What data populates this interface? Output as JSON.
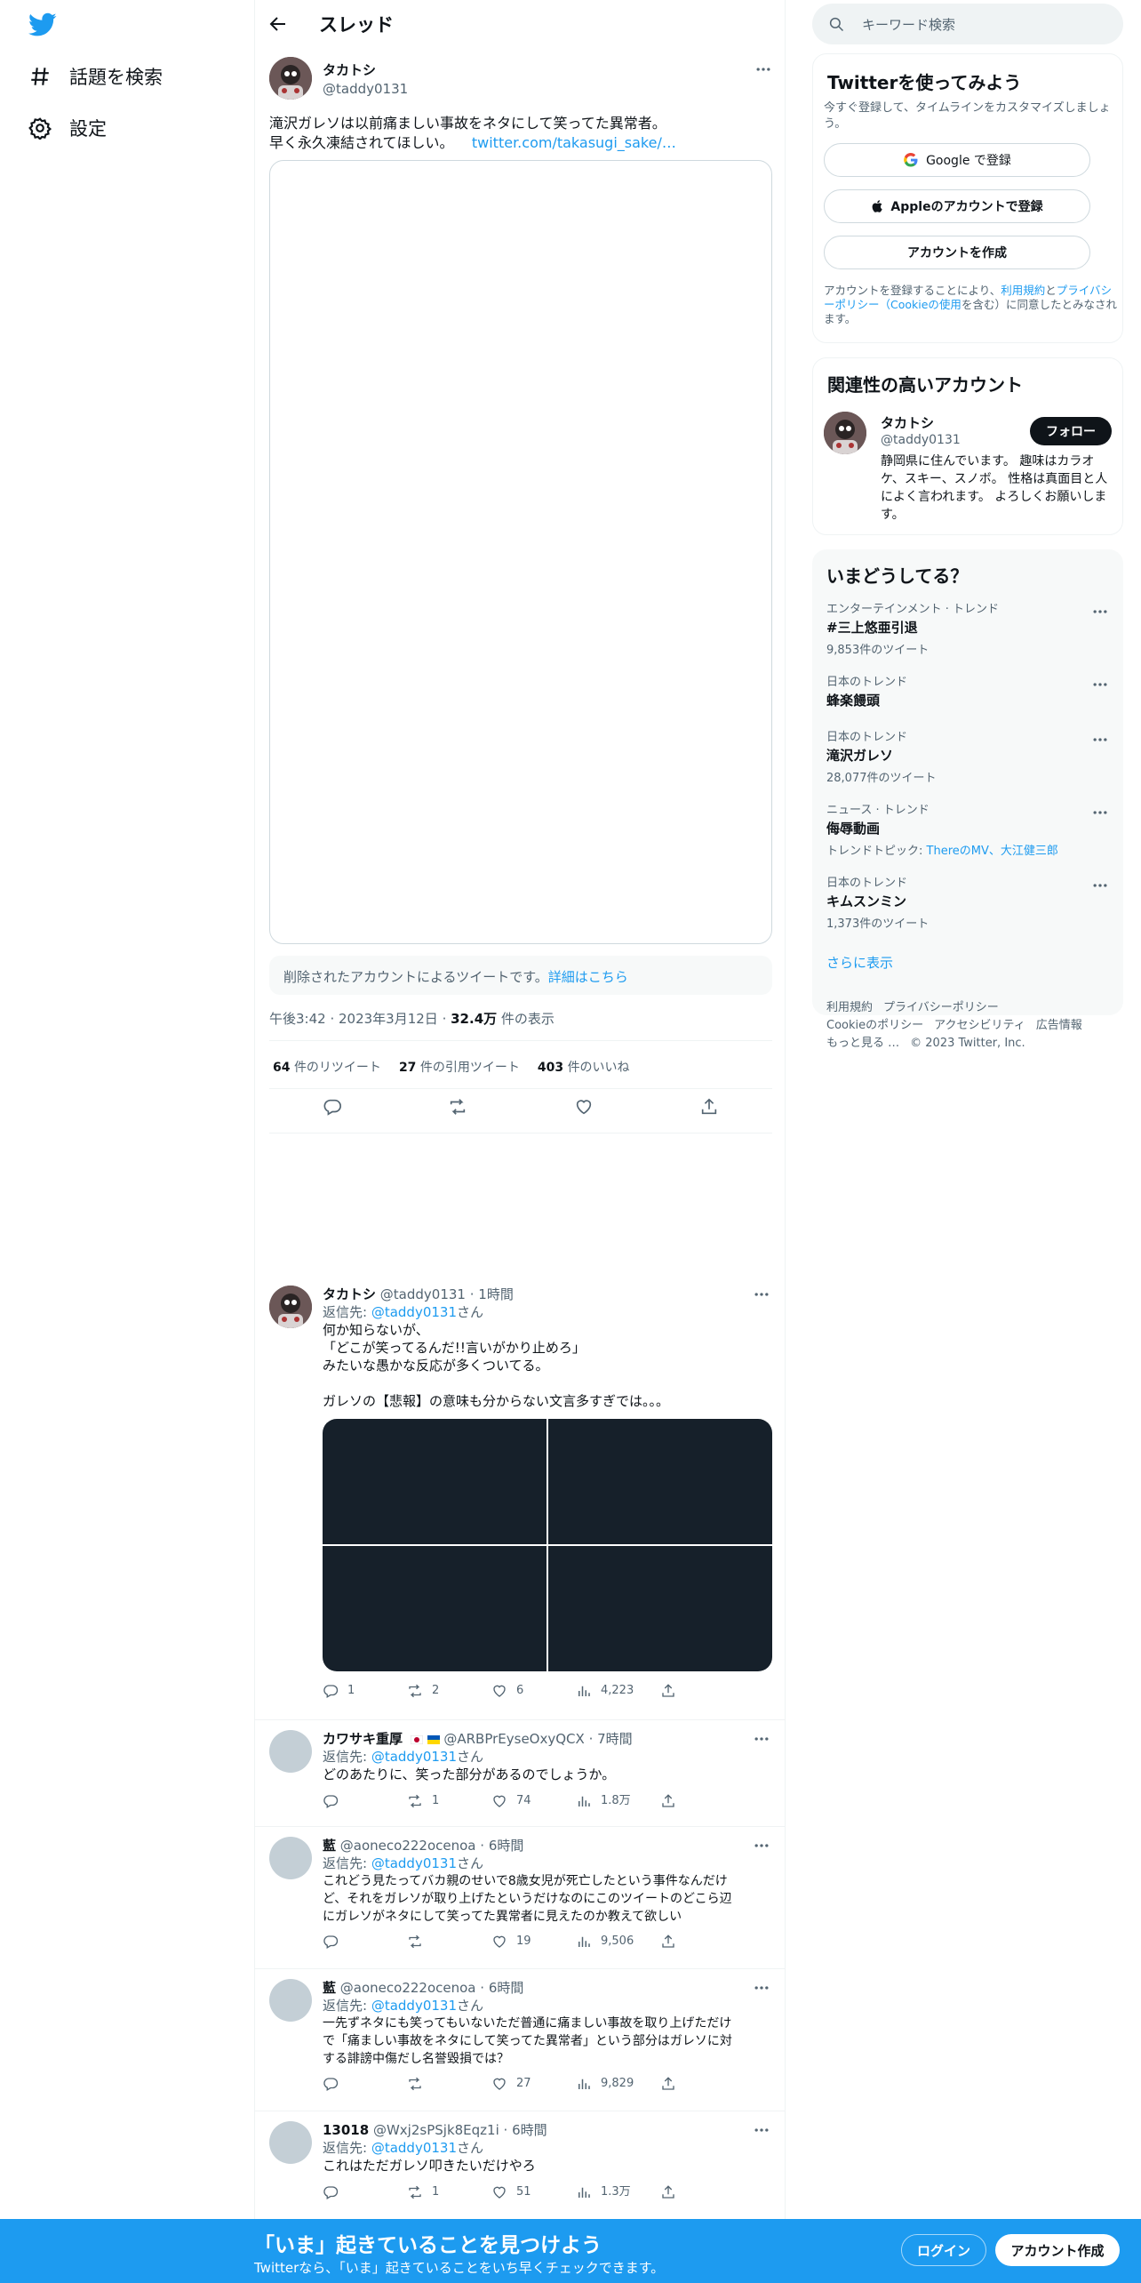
{
  "nav": {
    "explore": "話題を検索",
    "settings": "設定"
  },
  "header": {
    "title": "スレッド"
  },
  "main_tweet": {
    "name": "タカトシ",
    "handle": "@taddy0131",
    "text_line1": "滝沢ガレソは以前痛ましい事故をネタにして笑ってた異常者。",
    "text_line2": "早く永久凍結されてほしい。",
    "link": "twitter.com/takasugi_sake/…",
    "deleted_notice": "削除されたアカウントによるツイートです。",
    "deleted_link": "詳細はこちら",
    "time": "午後3:42",
    "date": "2023年3月12日",
    "views_count": "32.4万",
    "views_label": "件の表示",
    "retweets_count": "64",
    "retweets_label": "件のリツイート",
    "quotes_count": "27",
    "quotes_label": "件の引用ツイート",
    "likes_count": "403",
    "likes_label": "件のいいね"
  },
  "replies": [
    {
      "name": "タカトシ",
      "handle": "@taddy0131",
      "time": "1時間",
      "reply_to_prefix": "返信先: ",
      "reply_to": "@taddy0131",
      "reply_to_suffix": "さん",
      "lines": [
        "何か知らないが、",
        "「どこが笑ってるんだ!!言いがかり止めろ」",
        "みたいな愚かな反応が多くついてる。",
        "",
        "ガレソの【悲報】の意味も分からない文言多すぎでは。。。"
      ],
      "replies": "1",
      "retweets": "2",
      "likes": "6",
      "views": "4,223"
    },
    {
      "name": "カワサキ重厚",
      "handle": "@ARBPrEyseOxyQCX",
      "time": "7時間",
      "reply_to_prefix": "返信先: ",
      "reply_to": "@taddy0131",
      "reply_to_suffix": "さん",
      "lines": [
        "どのあたりに、笑った部分があるのでしょうか。"
      ],
      "replies": "",
      "retweets": "1",
      "likes": "74",
      "views": "1.8万"
    },
    {
      "name": "藍",
      "handle": "@aoneco222ocenoa",
      "time": "6時間",
      "reply_to_prefix": "返信先: ",
      "reply_to": "@taddy0131",
      "reply_to_suffix": "さん",
      "lines": [
        "これどう見たってバカ親のせいで8歳女児が死亡したという事件なんだけ",
        "ど、それをガレソが取り上げたというだけなのにこのツイートのどこら辺",
        "にガレソがネタにして笑ってた異常者に見えたのか教えて欲しい"
      ],
      "replies": "",
      "retweets": "",
      "likes": "19",
      "views": "9,506"
    },
    {
      "name": "藍",
      "handle": "@aoneco222ocenoa",
      "time": "6時間",
      "reply_to_prefix": "返信先: ",
      "reply_to": "@taddy0131",
      "reply_to_suffix": "さん",
      "lines": [
        "一先ずネタにも笑ってもいないただ普通に痛ましい事故を取り上げただけ",
        "で「痛ましい事故をネタにして笑ってた異常者」という部分はガレソに対",
        "する誹謗中傷だし名誉毀損では？"
      ],
      "replies": "",
      "retweets": "",
      "likes": "27",
      "views": "9,829"
    },
    {
      "name": "13018",
      "handle": "@Wxj2sPSjk8Eqz1i",
      "time": "6時間",
      "reply_to_prefix": "返信先: ",
      "reply_to": "@taddy0131",
      "reply_to_suffix": "さん",
      "lines": [
        "これはただガレソ叩きたいだけやろ"
      ],
      "replies": "",
      "retweets": "1",
      "likes": "51",
      "views": "1.3万"
    }
  ],
  "sidebar": {
    "search_placeholder": "キーワード検索",
    "signup_title": "Twitterを使ってみよう",
    "signup_desc": "今すぐ登録して、タイムラインをカスタマイズしましょう。",
    "google_btn": "Google で登録",
    "apple_btn": "Appleのアカウントで登録",
    "create_btn": "アカウントを作成",
    "terms_pre": "アカウントを登録することにより、",
    "terms_link1": "利用規約",
    "terms_and": "と",
    "terms_link2": "プライバシーポリシー（Cookieの使用",
    "terms_post": "を含む）に同意したとみなされます。",
    "related_title": "関連性の高いアカウント",
    "related_name": "タカトシ",
    "related_handle": "@taddy0131",
    "follow_btn": "フォロー",
    "related_bio": "静岡県に住んでいます。 趣味はカラオケ、スキー、スノボ。 性格は真面目と人によく言われます。 よろしくお願いします。",
    "trends_title": "いまどうしてる？",
    "trends": [
      {
        "category": "エンターテインメント · トレンド",
        "name": "#三上悠亜引退",
        "count": "9,853件のツイート"
      },
      {
        "category": "日本のトレンド",
        "name": "蜂楽饅頭",
        "count": ""
      },
      {
        "category": "日本のトレンド",
        "name": "滝沢ガレソ",
        "count": "28,077件のツイート"
      },
      {
        "category": "ニュース · トレンド",
        "name": "侮辱動画",
        "count_prefix": "トレンドトピック: ",
        "count_links": "ThereのMV、大江健三郎"
      },
      {
        "category": "日本のトレンド",
        "name": "キムスンミン",
        "count": "1,373件のツイート"
      }
    ],
    "show_more": "さらに表示",
    "footer": [
      "利用規約",
      "プライバシーポリシー",
      "Cookieのポリシー",
      "アクセシビリティ",
      "広告情報",
      "もっと見る …",
      "© 2023 Twitter, Inc."
    ]
  },
  "bottom_bar": {
    "title": "「いま」起きていることを見つけよう",
    "subtitle": "Twitterなら、「いま」起きていることをいち早くチェックできます。",
    "login": "ログイン",
    "signup": "アカウント作成"
  },
  "colors": {
    "accent": "#1d9bf0",
    "text": "#0f1419",
    "muted": "#536471"
  }
}
